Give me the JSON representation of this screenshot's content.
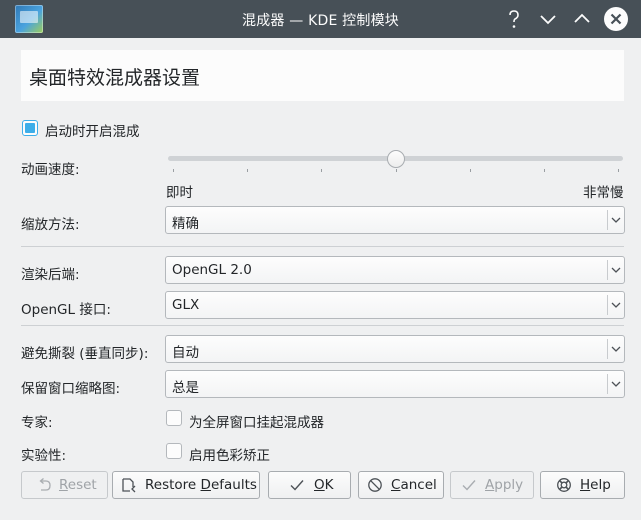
{
  "window": {
    "title": "混成器 — KDE 控制模块",
    "controls": {
      "help": "help",
      "minimize": "minimize",
      "maximize": "maximize",
      "close": "close"
    }
  },
  "header": {
    "title": "桌面特效混成器设置"
  },
  "start_on_boot": {
    "label": "启动时开启混成",
    "checked": true
  },
  "animation_speed": {
    "label": "动画速度:",
    "min_label": "即时",
    "max_label": "非常慢",
    "tick_count": 7,
    "value_fraction": 0.5
  },
  "scale_method": {
    "label": "缩放方法:",
    "value": "精确"
  },
  "render_backend": {
    "label": "渲染后端:",
    "value": "OpenGL 2.0"
  },
  "opengl_interface": {
    "label": "OpenGL 接口:",
    "value": "GLX"
  },
  "tearing_prevention": {
    "label": "避免撕裂 (垂直同步):",
    "value": "自动"
  },
  "keep_thumbnails": {
    "label": "保留窗口缩略图:",
    "value": "总是"
  },
  "expert": {
    "label": "专家:",
    "option": "为全屏窗口挂起混成器",
    "checked": false
  },
  "experimental": {
    "label": "实验性:",
    "option": "启用色彩矫正",
    "checked": false
  },
  "buttons": {
    "reset": {
      "mnemonic": "R",
      "rest": "eset",
      "enabled": false
    },
    "restore_defaults": {
      "pre": "Restore ",
      "mnemonic": "D",
      "rest": "efaults",
      "enabled": true
    },
    "ok": {
      "mnemonic": "O",
      "rest": "K",
      "enabled": true
    },
    "cancel": {
      "mnemonic": "C",
      "rest": "ancel",
      "enabled": true
    },
    "apply": {
      "mnemonic": "A",
      "rest": "pply",
      "enabled": false
    },
    "help": {
      "mnemonic": "H",
      "rest": "elp",
      "enabled": true
    }
  },
  "colors": {
    "titlebar": "#475057",
    "window_bg": "#eff0f1",
    "accent": "#3daee9",
    "text": "#232629",
    "disabled_text": "#9fa3a7"
  }
}
